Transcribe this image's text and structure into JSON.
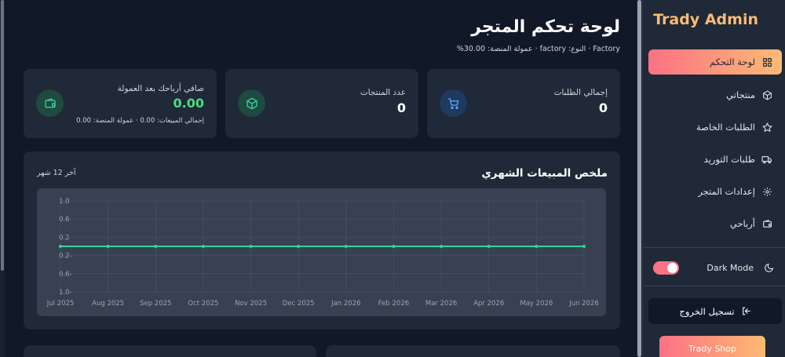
{
  "brand": "Trady Admin",
  "header": {
    "title": "لوحة تحكم المتجر",
    "subtitle_parts": [
      "%30.00",
      ":عمولة المنصة",
      "·",
      "factory",
      ":النوع",
      "·",
      "Factory"
    ]
  },
  "stats": [
    {
      "title": "إجمالي الطلبات",
      "value": "0",
      "icon": "cart-icon"
    },
    {
      "title": "عدد المنتجات",
      "value": "0",
      "icon": "box-icon"
    },
    {
      "title": "صافي أرباحك بعد العمولة",
      "value": "0.00",
      "extra": "إجمالي المبيعات: 0.00 · عمولة المنصة: 0.00",
      "icon": "wallet-icon"
    }
  ],
  "chart": {
    "title": "ملخص المبيعات الشهري",
    "range_label": "آخر 12 شهر"
  },
  "chart_data": {
    "type": "line",
    "categories": [
      "Jul 2025",
      "Aug 2025",
      "Sep 2025",
      "Oct 2025",
      "Nov 2025",
      "Dec 2025",
      "Jan 2026",
      "Feb 2026",
      "Mar 2026",
      "Apr 2026",
      "May 2026",
      "Jun 2026"
    ],
    "series": [
      {
        "values": [
          0,
          0,
          0,
          0,
          0,
          0,
          0,
          0,
          0,
          0,
          0,
          0
        ]
      }
    ],
    "y_ticks": [
      "1.0",
      "0.6",
      "0.2",
      "-0.2",
      "-0.6",
      "-1.0"
    ],
    "ylim": [
      -1.0,
      1.0
    ],
    "grid": true,
    "line_color": "#34d399"
  },
  "sidebar": {
    "items": [
      {
        "label": "لوحة التحكم",
        "icon": "dashboard-icon",
        "active": true
      },
      {
        "label": "منتجاتي",
        "icon": "box-icon",
        "active": false
      },
      {
        "label": "الطلبات الخاصة",
        "icon": "star-icon",
        "active": false
      },
      {
        "label": "طلبات التوريد",
        "icon": "truck-icon",
        "active": false
      },
      {
        "label": "إعدادات المتجر",
        "icon": "gear-icon",
        "active": false
      },
      {
        "label": "أرباحي",
        "icon": "wallet-icon",
        "active": false
      }
    ],
    "dark_mode_label": "Dark Mode",
    "dark_mode_on": true,
    "logout_label": "تسجيل الخروج",
    "shop_label": "Trady Shop"
  },
  "colors": {
    "accent_start": "#fb7185",
    "accent_end": "#fdba74",
    "brand": "#fdba74",
    "positive": "#4ade80"
  }
}
